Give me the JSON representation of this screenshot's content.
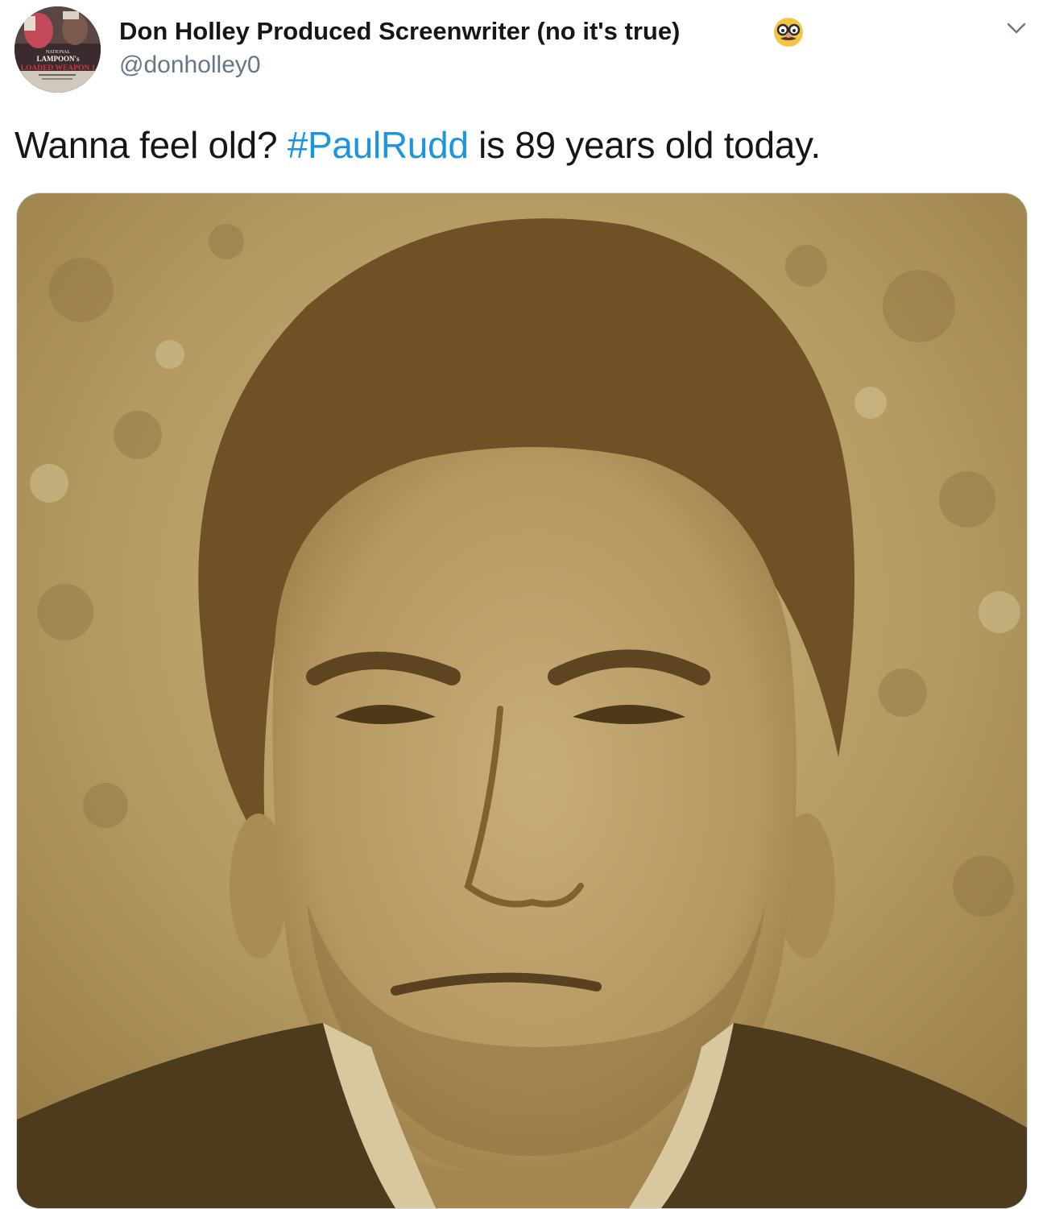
{
  "tweet": {
    "author_name": "Don Holley Produced Screenwriter (no it's true)",
    "author_emoji": "disguised-face-emoji",
    "handle": "@donholley0",
    "text_before": "Wanna feel old? ",
    "hashtag": "#PaulRudd",
    "text_after": " is 89 years old today.",
    "avatar_text": {
      "line1": "NATIONAL",
      "line2": "LAMPOON's",
      "line3": "LOADED WEAPON 1"
    },
    "media_alt": "Sepia-toned portrait photo of a man with dark hair",
    "menu_icon": "chevron-down-icon"
  },
  "colors": {
    "text": "#14171a",
    "secondary_text": "#657786",
    "link": "#1b95e0",
    "sepia": "#b09560"
  }
}
